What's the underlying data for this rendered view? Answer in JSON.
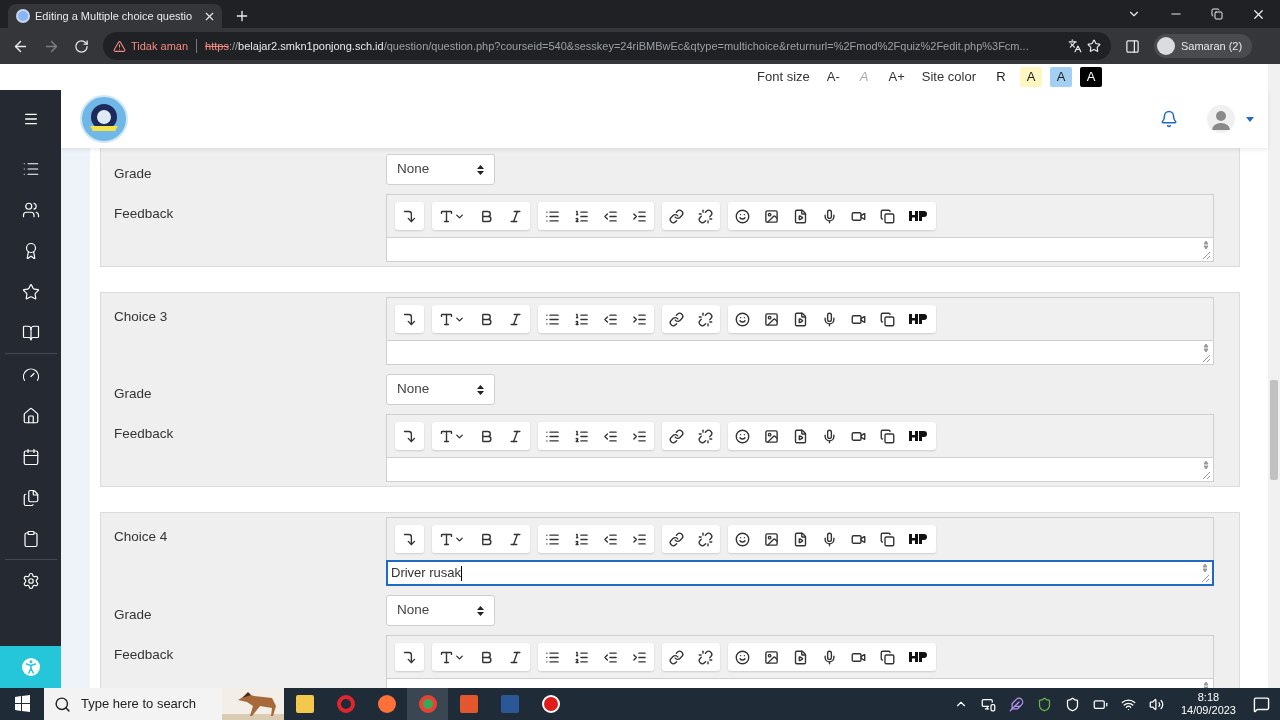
{
  "browser": {
    "tab": {
      "title": "Editing a Multiple choice questio"
    },
    "address": {
      "warning": "Tidak aman",
      "scheme": "https",
      "separator": "://",
      "host": "belajar2.smkn1ponjong.sch.id",
      "path": "/question/question.php?courseid=540&sesskey=24riBMBwEc&qtype=multichoice&returnurl=%2Fmod%2Fquiz%2Fedit.php%3Fcm..."
    },
    "profile": "Samaran (2)"
  },
  "accessibility_bar": {
    "font_size_label": "Font size",
    "font_buttons": [
      {
        "label": "A-",
        "disabled": false
      },
      {
        "label": "A",
        "disabled": true
      },
      {
        "label": "A+",
        "disabled": false
      }
    ],
    "site_color_label": "Site color",
    "color_buttons": [
      {
        "label": "R",
        "color": "#ffffff"
      },
      {
        "label": "A",
        "color": "#fff7c2"
      },
      {
        "label": "A",
        "color": "#a3d0f2"
      },
      {
        "label": "A",
        "color": "#000000"
      }
    ]
  },
  "sections": [
    {
      "rows": [
        {
          "kind": "select",
          "label": "Grade",
          "value": "None"
        },
        {
          "kind": "editor",
          "label": "Feedback",
          "focused": false
        }
      ]
    },
    {
      "rows": [
        {
          "kind": "editor",
          "label": "Choice 3",
          "focused": false
        },
        {
          "kind": "select",
          "label": "Grade",
          "value": "None"
        },
        {
          "kind": "editor",
          "label": "Feedback",
          "focused": false
        }
      ]
    },
    {
      "rows": [
        {
          "kind": "editor",
          "label": "Choice 4",
          "text": "Driver rusak",
          "focused": true
        },
        {
          "kind": "select",
          "label": "Grade",
          "value": "None"
        },
        {
          "kind": "editor",
          "label": "Feedback",
          "focused": false
        }
      ]
    }
  ],
  "taskbar": {
    "search_placeholder": "Type here to search",
    "time": "8:18",
    "date": "14/09/2023"
  }
}
